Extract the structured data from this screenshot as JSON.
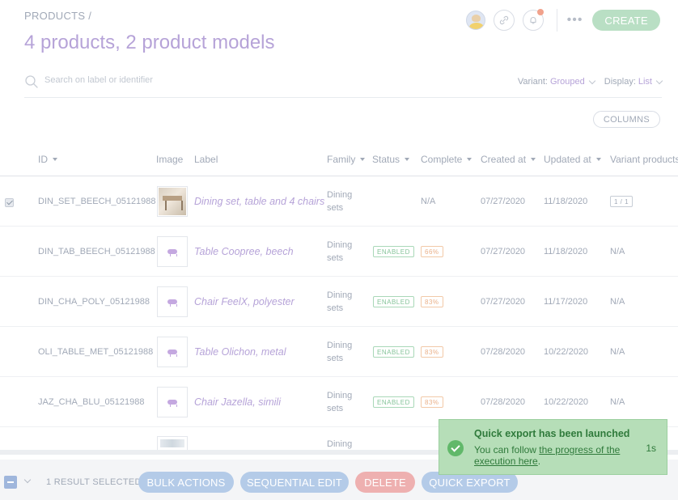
{
  "header": {
    "breadcrumb": "PRODUCTS /",
    "title": "4 products, 2 product models",
    "create_label": "CREATE"
  },
  "search": {
    "placeholder": "Search on label or identifier",
    "variant_label": "Variant:",
    "variant_value": "Grouped",
    "display_label": "Display:",
    "display_value": "List"
  },
  "columns_label": "COLUMNS",
  "table": {
    "headers": {
      "id": "ID",
      "image": "Image",
      "label": "Label",
      "family": "Family",
      "status": "Status",
      "complete": "Complete",
      "created": "Created at",
      "updated": "Updated at",
      "variant": "Variant products"
    },
    "rows": [
      {
        "id": "DIN_SET_BEECH_05121988",
        "label": "Dining set, table and 4 chairs",
        "family_1": "Dining",
        "family_2": "sets",
        "status": "",
        "complete": "N/A",
        "created": "07/27/2020",
        "updated": "11/18/2020",
        "variant": "1 / 1"
      },
      {
        "id": "DIN_TAB_BEECH_05121988",
        "label": "Table Coopree, beech",
        "family_1": "Dining",
        "family_2": "sets",
        "status": "ENABLED",
        "complete": "66%",
        "created": "07/27/2020",
        "updated": "11/18/2020",
        "variant": "N/A"
      },
      {
        "id": "DIN_CHA_POLY_05121988",
        "label": "Chair FeelX, polyester",
        "family_1": "Dining",
        "family_2": "sets",
        "status": "ENABLED",
        "complete": "83%",
        "created": "07/27/2020",
        "updated": "11/17/2020",
        "variant": "N/A"
      },
      {
        "id": "OLI_TABLE_MET_05121988",
        "label": "Table Olichon, metal",
        "family_1": "Dining",
        "family_2": "sets",
        "status": "ENABLED",
        "complete": "83%",
        "created": "07/28/2020",
        "updated": "10/22/2020",
        "variant": "N/A"
      },
      {
        "id": "JAZ_CHA_BLU_05121988",
        "label": "Chair Jazella, simili",
        "family_1": "Dining",
        "family_2": "sets",
        "status": "ENABLED",
        "complete": "83%",
        "created": "07/28/2020",
        "updated": "10/22/2020",
        "variant": "N/A"
      }
    ],
    "partial_family": "Dining"
  },
  "bottom_bar": {
    "selection_text": "1 RESULT SELECTED",
    "bulk_actions": "BULK ACTIONS",
    "sequential_edit": "SEQUENTIAL EDIT",
    "delete": "DELETE",
    "quick_export": "QUICK EXPORT"
  },
  "toast": {
    "title": "Quick export has been launched",
    "message_prefix": "You can follow ",
    "message_link": "the progress of the execution here",
    "message_suffix": ".",
    "time": "1s"
  },
  "icons": {
    "avatar": "user-avatar",
    "link": "link-icon",
    "bell": "bell-icon",
    "more": "more-icon",
    "search": "search-icon",
    "toast": "check-circle-icon"
  },
  "colors": {
    "accent_purple": "#b6a3d8",
    "create_green": "#b9dfc4",
    "action_blue": "#b4cbe8",
    "delete_red": "#eeb0b0",
    "toast_bg": "#b6deb8"
  }
}
